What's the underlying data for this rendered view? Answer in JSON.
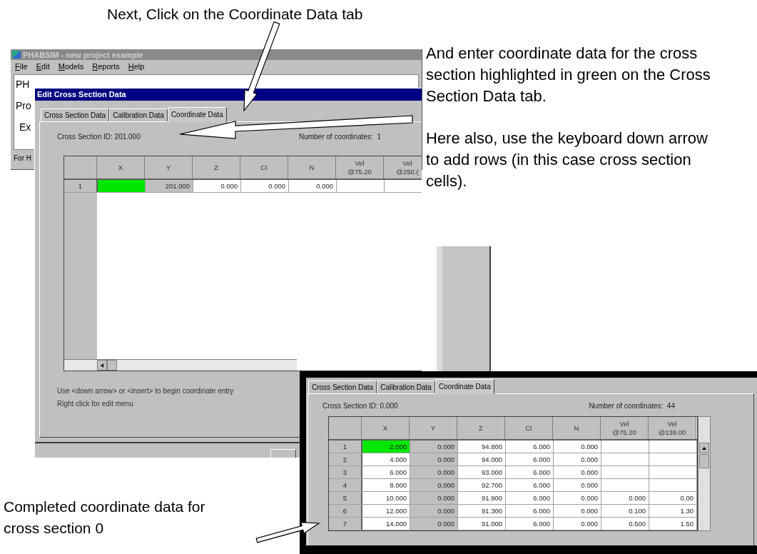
{
  "instruction_top": "Next, Click on the Coordinate Data tab",
  "main_window": {
    "title": "PHABSIM - new project example",
    "menu": [
      "File",
      "Edit",
      "Models",
      "Reports",
      "Help"
    ],
    "content": [
      "PH",
      "Pro",
      "Ex"
    ],
    "status_bar": "For H"
  },
  "dialog": {
    "title": "Edit Cross Section Data",
    "tabs": [
      {
        "label": "Cross Section Data",
        "selected": false
      },
      {
        "label": "Calibration Data",
        "selected": false
      },
      {
        "label": "Coordinate Data",
        "selected": true
      }
    ],
    "id_label": "Cross Section ID:",
    "id_value": "201.000",
    "count_label": "Number of coordinates:",
    "count_value": "1",
    "columns": [
      "X",
      "Y",
      "Z",
      "CI",
      "N",
      "Vel\n@75.20",
      "Vel\n@250.("
    ],
    "rows": [
      {
        "num": "1",
        "highlighted": true,
        "cells": [
          null,
          "201.000",
          "0.000",
          "0.000",
          "0.000",
          null,
          null
        ]
      }
    ],
    "hints": [
      "Use <down arrow> or <insert> to begin coordinate entry",
      "Right click for edit menu"
    ]
  },
  "instruction_right": [
    "And enter coordinate data for the cross section highlighted in green on the Cross Section Data tab.",
    "Here also, use the keyboard down arrow to add rows (in this case cross section cells)."
  ],
  "completed_panel": {
    "tabs": [
      {
        "label": "Cross Section Data",
        "selected": false
      },
      {
        "label": "Calibration Data",
        "selected": false
      },
      {
        "label": "Coordinate Data",
        "selected": true
      }
    ],
    "id_label": "Cross Section ID:",
    "id_value": "0.000",
    "count_label": "Number of coordinates:",
    "count_value": "44",
    "columns": [
      "X",
      "Y",
      "Z",
      "CI",
      "N",
      "Vel\n@75.20",
      "Vel\n@139.00"
    ],
    "rows": [
      {
        "num": "1",
        "highlighted": true,
        "cells": [
          "2.000",
          "0.000",
          "94.800",
          "6.000",
          "0.000",
          null,
          null
        ]
      },
      {
        "num": "2",
        "highlighted": false,
        "cells": [
          "4.000",
          "0.000",
          "94.000",
          "6.000",
          "0.000",
          null,
          null
        ]
      },
      {
        "num": "3",
        "highlighted": false,
        "cells": [
          "6.000",
          "0.000",
          "93.000",
          "6.000",
          "0.000",
          null,
          null
        ]
      },
      {
        "num": "4",
        "highlighted": false,
        "cells": [
          "8.000",
          "0.000",
          "92.700",
          "6.000",
          "0.000",
          null,
          null
        ]
      },
      {
        "num": "5",
        "highlighted": false,
        "cells": [
          "10.000",
          "0.000",
          "91.900",
          "6.000",
          "0.000",
          "0.000",
          "0.00"
        ]
      },
      {
        "num": "6",
        "highlighted": false,
        "cells": [
          "12.000",
          "0.000",
          "91.300",
          "6.000",
          "0.000",
          "0.100",
          "1.30"
        ]
      },
      {
        "num": "7",
        "highlighted": false,
        "cells": [
          "14.000",
          "0.000",
          "91.000",
          "6.000",
          "0.000",
          "0.500",
          "1.50"
        ]
      }
    ]
  },
  "caption_bottom": "Completed coordinate data for cross section 0"
}
